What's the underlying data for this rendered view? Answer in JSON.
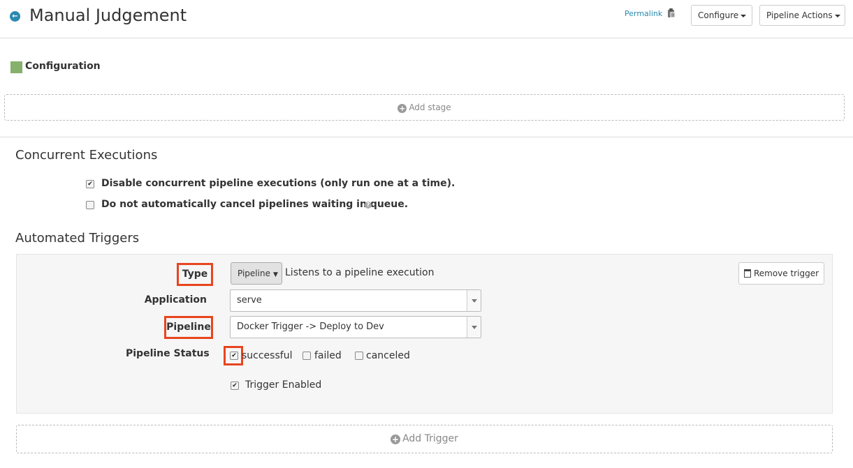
{
  "header": {
    "title": "Manual Judgement",
    "permalink": "Permalink",
    "configure": "Configure",
    "pipeline_actions": "Pipeline Actions"
  },
  "config": {
    "label": "Configuration",
    "add_stage": "Add stage"
  },
  "concurrent": {
    "title": "Concurrent Executions",
    "disable_label": "Disable concurrent pipeline executions (only run one at a time).",
    "disable_checked": true,
    "cancel_label": "Do not automatically cancel pipelines waiting in queue.",
    "cancel_checked": false
  },
  "triggers": {
    "title": "Automated Triggers",
    "type_label": "Type",
    "type_value": "Pipeline",
    "type_desc": "Listens to a pipeline execution",
    "remove": "Remove trigger",
    "application_label": "Application",
    "application_value": "serve",
    "pipeline_label": "Pipeline",
    "pipeline_value": "Docker Trigger -> Deploy to Dev",
    "status_label": "Pipeline Status",
    "status_successful": "successful",
    "status_failed": "failed",
    "status_canceled": "canceled",
    "enabled_label": "Trigger Enabled",
    "add_trigger": "Add Trigger"
  },
  "colors": {
    "accent": "#2a8ab0",
    "stage_color": "#86b16a",
    "highlight": "#e8451f"
  }
}
